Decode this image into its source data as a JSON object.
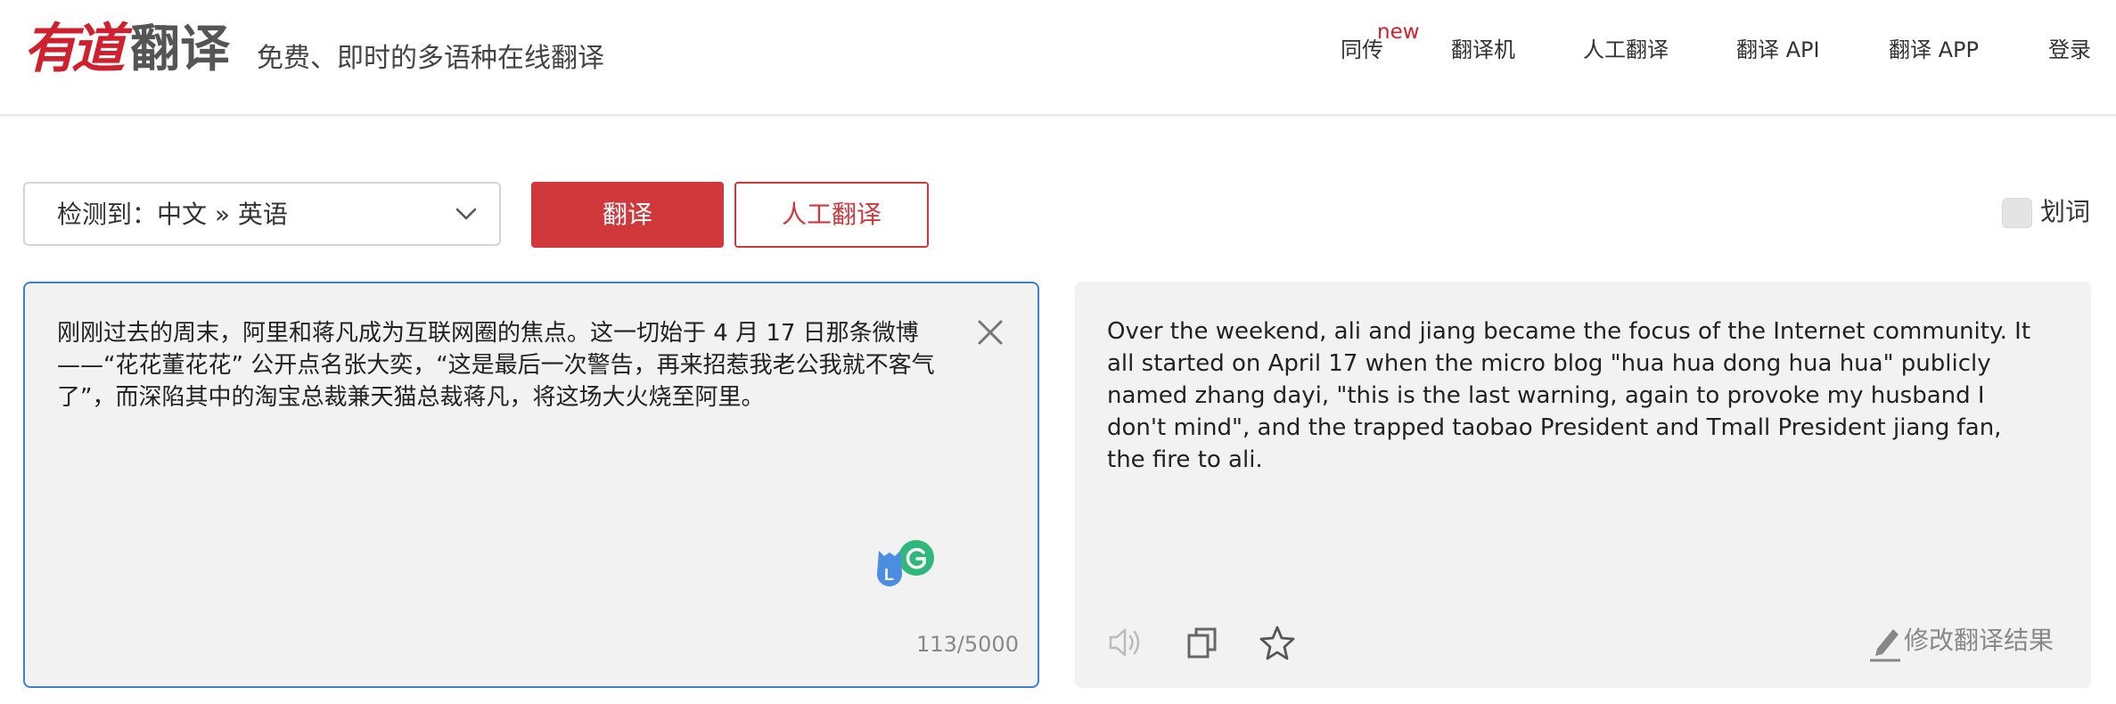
{
  "header": {
    "logo_you": "有道",
    "logo_fanyi": "翻译",
    "slogan": "免费、即时的多语种在线翻译",
    "nav": [
      {
        "label": "同传",
        "badge": "new"
      },
      {
        "label": "翻译机"
      },
      {
        "label": "人工翻译"
      },
      {
        "label": "翻译 API"
      },
      {
        "label": "翻译 APP"
      },
      {
        "label": "登录"
      }
    ]
  },
  "toolbar": {
    "lang_selector": "检测到：中文  »  英语",
    "translate_button": "翻译",
    "human_translate_button": "人工翻译",
    "huaci_label": "划词"
  },
  "source": {
    "text": "刚刚过去的周末，阿里和蒋凡成为互联网圈的焦点。这一切始于 4 月 17 日那条微博 ——“花花董花花” 公开点名张大奕，“这是最后一次警告，再来招惹我老公我就不客气了”，而深陷其中的淘宝总裁兼天猫总裁蒋凡，将这场大火烧至阿里。",
    "char_count": "113/5000"
  },
  "target": {
    "text": "Over the weekend, ali and jiang became the focus of the Internet community. It all started on April 17 when the micro blog \"hua hua dong hua hua\" publicly named zhang dayi, \"this is the last warning, again to provoke my husband I don't mind\", and the trapped taobao President and Tmall President jiang fan, the fire to ali.",
    "edit_label": "修改翻译结果"
  },
  "colors": {
    "brand_red": "#d0383c",
    "focus_blue": "#3c7fd4",
    "panel_bg": "#f2f2f2"
  }
}
